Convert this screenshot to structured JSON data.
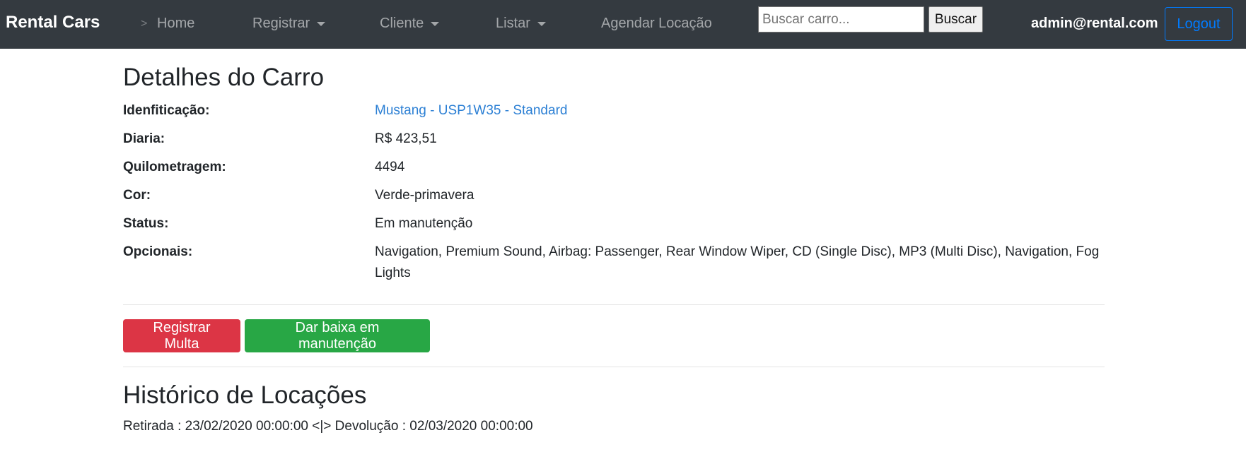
{
  "navbar": {
    "brand": "Rental Cars",
    "separator": ">",
    "links": {
      "home": "Home",
      "registrar": "Registrar",
      "cliente": "Cliente",
      "listar": "Listar",
      "agendar": "Agendar Locação"
    },
    "search": {
      "placeholder": "Buscar carro...",
      "value": "",
      "button": "Buscar"
    },
    "user_email": "admin@rental.com",
    "logout": "Logout"
  },
  "car": {
    "title": "Detalhes do Carro",
    "fields": [
      {
        "label": "Idenfiticação:",
        "value": "Mustang - USP1W35 - Standard"
      },
      {
        "label": "Diaria:",
        "value": "R$ 423,51"
      },
      {
        "label": "Quilometragem:",
        "value": "4494"
      },
      {
        "label": "Cor:",
        "value": "Verde-primavera"
      },
      {
        "label": "Status:",
        "value": "Em manutenção"
      },
      {
        "label": "Opcionais:",
        "value": "Navigation, Premium Sound, Airbag: Passenger, Rear Window Wiper, CD (Single Disc), MP3 (Multi Disc), Navigation, Fog Lights"
      }
    ]
  },
  "actions": {
    "fine": "Registrar Multa",
    "maintenance": "Dar baixa em manutenção"
  },
  "history": {
    "title": "Histórico de Locações",
    "entries": [
      "Retirada : 23/02/2020 00:00:00 <|> Devolução : 02/03/2020 00:00:00"
    ]
  },
  "colors": {
    "navbar_bg": "#343a40",
    "link": "#2b7fd4",
    "danger": "#dc3545",
    "success": "#28a745",
    "primary": "#007bff"
  }
}
